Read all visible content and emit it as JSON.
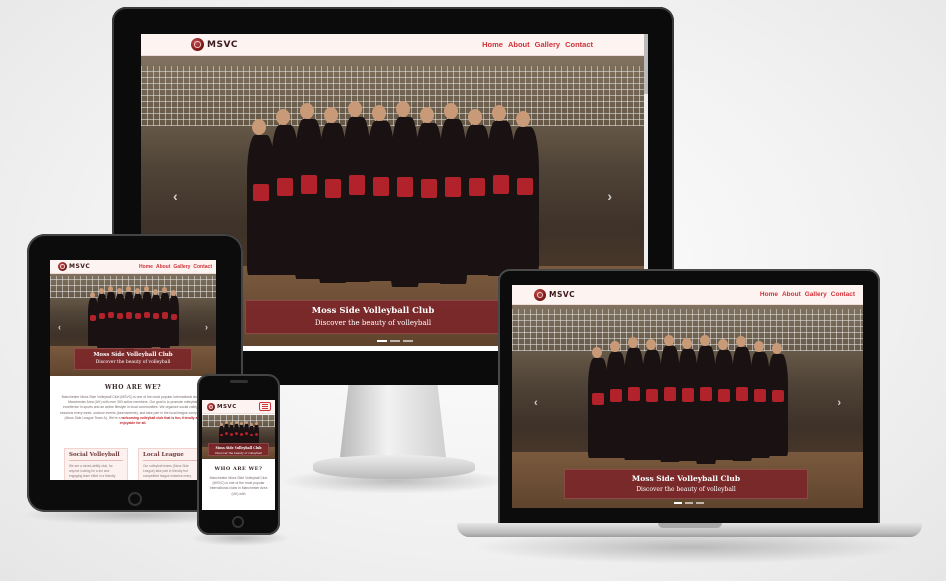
{
  "site": {
    "logo_text": "MSVC",
    "nav": [
      "Home",
      "About",
      "Gallery",
      "Contact"
    ],
    "hero": {
      "title": "Moss Side Volleyball Club",
      "subtitle": "Discover the beauty of volleyball"
    },
    "about": {
      "heading": "WHO ARE WE?",
      "text_desktop": "Manchester Moss Side Volleyball Club (MSVC) is one of the most popular International clubs in Manchester Area (UK) with over 300 active members. Our goal is to promote volleyball excellence in sports and an active lifestyle in local communities. We organize social volleyball sessions every week, outdoor events (tournaments), and take part in the local league competition (Moss Side League Team A). We’re a",
      "text_highlight": "welcoming volleyball club that is fun, friendly and enjoyable for all.",
      "text_mobile": "Manchester Moss Side Volleyball Club (MSVC) is one of the most popular International clubs in Manchester Area (UK) with"
    },
    "cards": [
      {
        "title": "Social Volleyball",
        "text": "We are a mixed-ability club, for anyone looking for a fun and engaging team effort in a friendly environment."
      },
      {
        "title": "Local League",
        "text": "Our volleyball teams (Moss Side League) take part in friendly but competitive league matches every season."
      }
    ]
  },
  "devices": [
    "desktop-monitor",
    "tablet",
    "phone",
    "laptop"
  ],
  "icons": {
    "prev": "‹",
    "next": "›"
  },
  "colors": {
    "accent": "#d0333a",
    "caption_bg": "#7c2328",
    "nav_bg": "#fdf3f1"
  }
}
